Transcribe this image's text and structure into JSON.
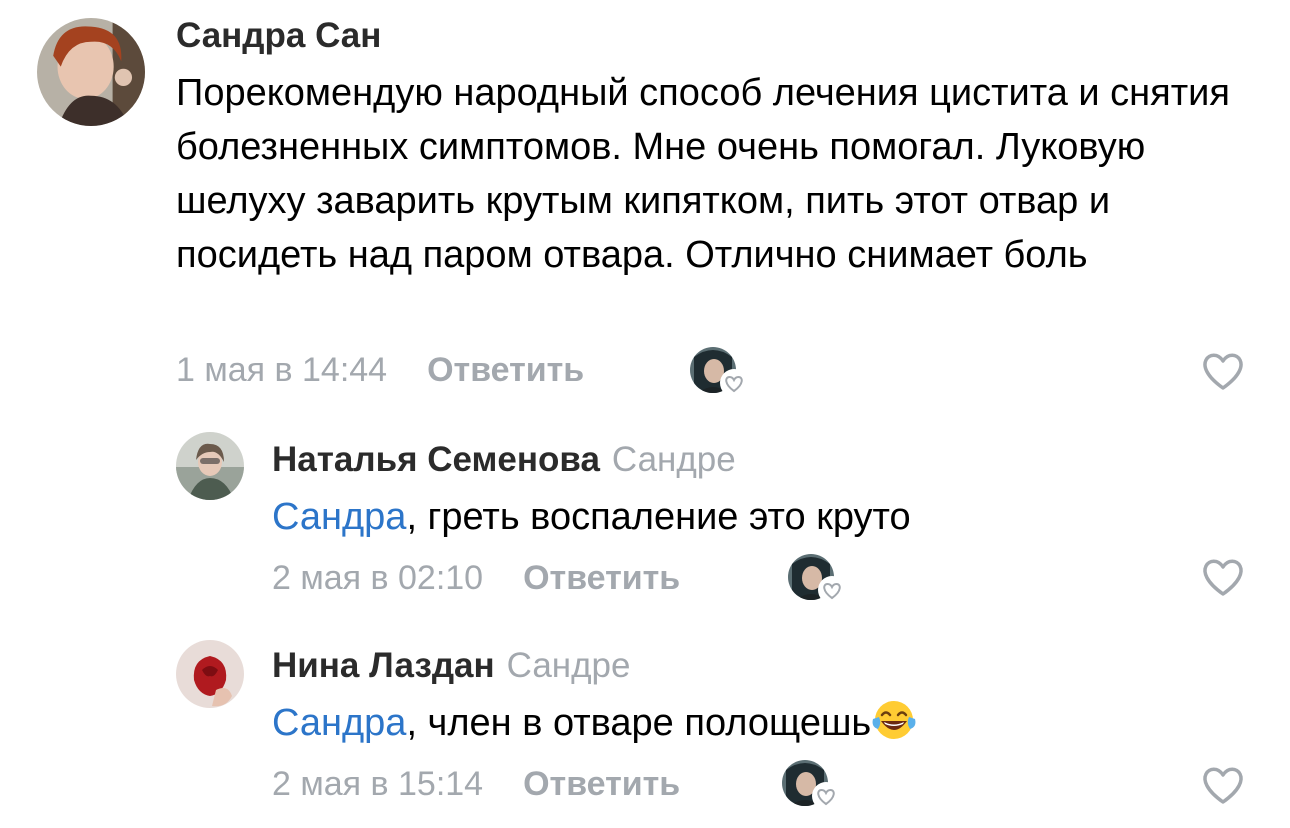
{
  "comments": [
    {
      "author": "Сандра Сан",
      "reply_to": "",
      "mention": "",
      "text": "Порекомендую народный способ лечения цистита и снятия болезненных симптомов. Мне очень помогал. Луковую шелуху заварить крутым кипятком, пить этот отвар и посидеть над паром отвара. Отлично снимает боль",
      "date": "1 мая в 14:44",
      "reply_label": "Ответить"
    },
    {
      "author": "Наталья Семенова",
      "reply_to": "Сандре",
      "mention": "Сандра",
      "text": ", греть воспаление это круто",
      "date": "2 мая в 02:10",
      "reply_label": "Ответить"
    },
    {
      "author": "Нина Лаздан",
      "reply_to": "Сандре",
      "mention": "Сандра",
      "text": ", член в отваре полощешь",
      "emoji": "laughing-with-tears-emoji",
      "date": "2 мая в 15:14",
      "reply_label": "Ответить"
    }
  ],
  "icons": {
    "like": "heart-outline-icon",
    "liker": "liker-avatar-with-heart"
  },
  "colors": {
    "text": "#000000",
    "author": "#2b2b2b",
    "muted": "#a3a8ae",
    "mention": "#2c75c9"
  }
}
